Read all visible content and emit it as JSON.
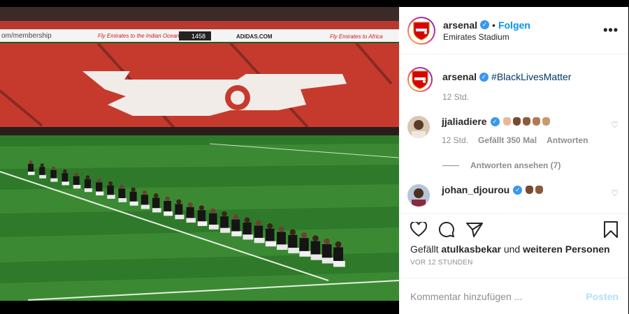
{
  "post": {
    "username": "arsenal",
    "follow_label": "Folgen",
    "separator": "•",
    "location": "Emirates Stadium",
    "more_label": "•••"
  },
  "photo": {
    "banner_left": "om/membership",
    "banner_mid": "Fly Emirates to the Indian Ocean",
    "banner_board": "1458",
    "banner_adidas": "ADIDAS.COM",
    "banner_right": "Fly Emirates to Africa"
  },
  "caption": {
    "username": "arsenal",
    "text": "#BlackLivesMatter",
    "time": "12 Std."
  },
  "comments": [
    {
      "username": "jjaliadiere",
      "emoji_colors": [
        "#e8b89a",
        "#7a4a2e",
        "#8a5a3a",
        "#b07a52",
        "#c99a70"
      ],
      "time": "12 Std.",
      "likes": "Gefällt 350 Mal",
      "reply_label": "Antworten",
      "replies_label": "Antworten ansehen (7)"
    },
    {
      "username": "johan_djourou",
      "emoji_colors": [
        "#7a4a2e",
        "#8a5a3a"
      ]
    }
  ],
  "footer": {
    "likes_prefix": "Gefällt",
    "liked_by": "atulkasbekar",
    "likes_middle": "und",
    "likes_others": "weiteren Personen",
    "time_ago": "VOR 12 STUNDEN",
    "comment_placeholder": "Kommentar hinzufügen ...",
    "post_label": "Posten"
  },
  "colors": {
    "accent": "#0095f6",
    "verified": "#3897f0",
    "arsenal_red": "#db0007",
    "seat_red": "#c63a2e"
  }
}
